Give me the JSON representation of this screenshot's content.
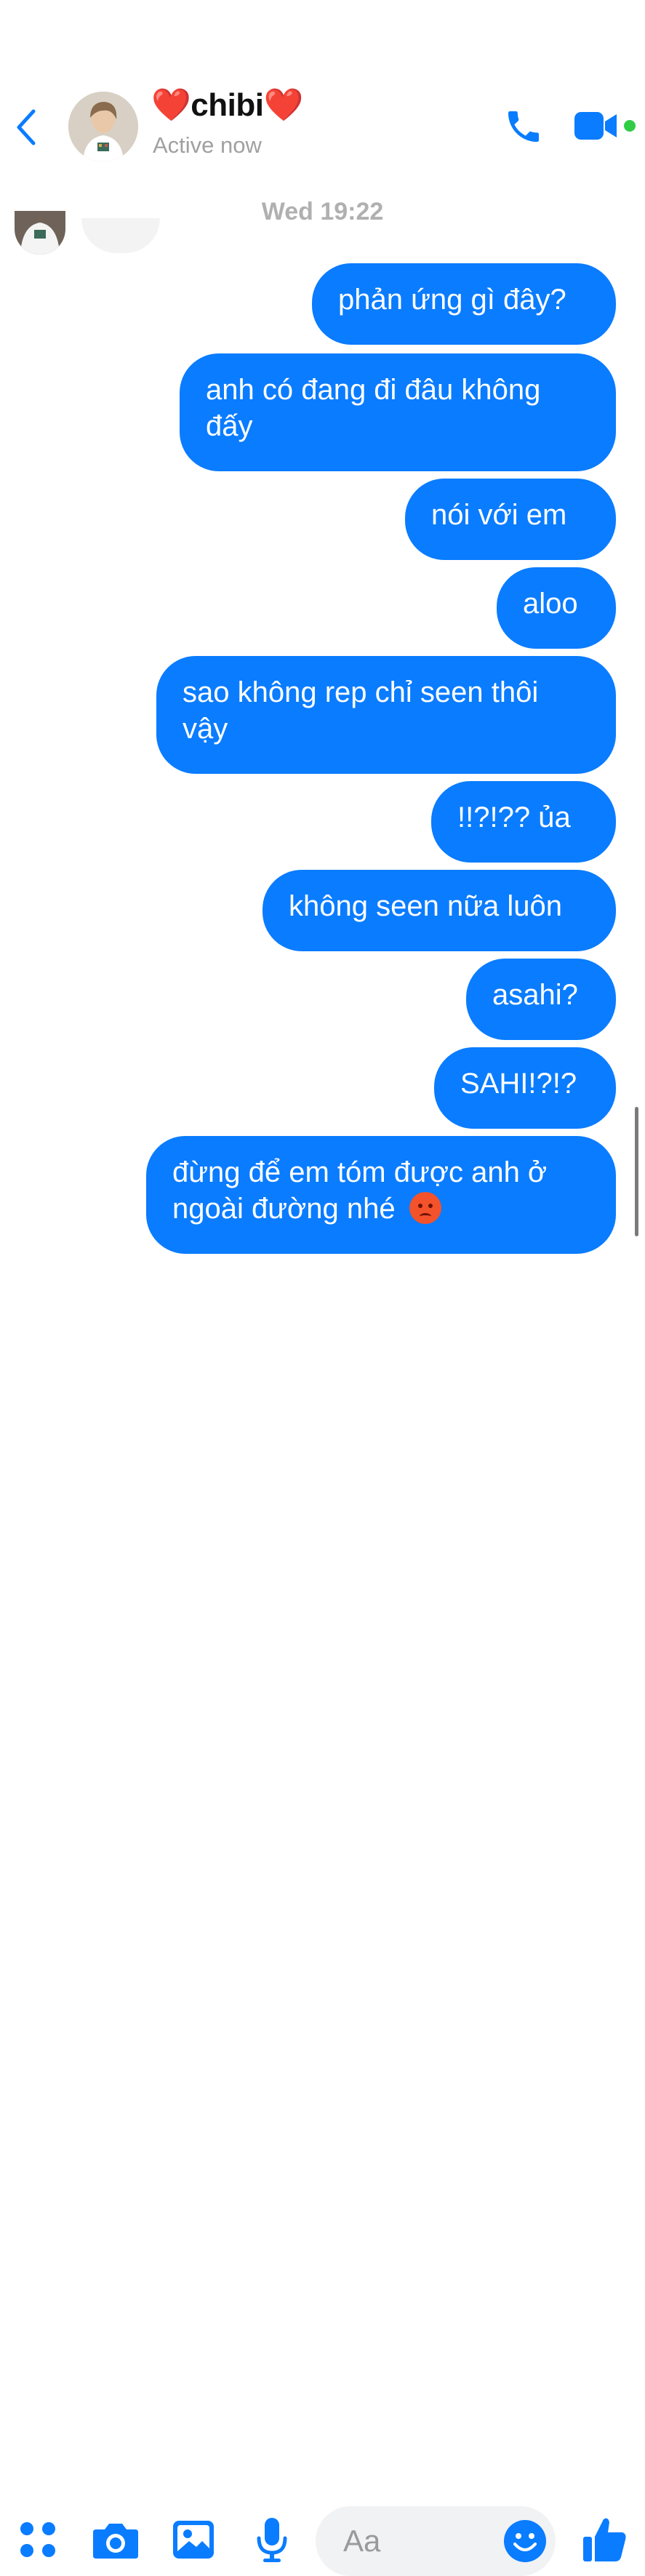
{
  "header": {
    "back_icon": "chevron-left-icon",
    "avatar_icon": "profile-photo",
    "contact_name": "❤️chibi❤️",
    "status": "Active now",
    "call_icon": "phone-icon",
    "video_icon": "video-camera-icon",
    "accent_color": "#0a7cff",
    "active_color": "#31cc46"
  },
  "thread": {
    "timestamp": "Wed 19:22",
    "messages": [
      "phản ứng gì đây?",
      "anh có đang đi đâu không đấy",
      "nói với em",
      "aloo",
      "sao không rep chỉ seen thôi vậy",
      "!!?!?? ủa",
      "không seen nữa luôn",
      "asahi?",
      "SAHI!?!?",
      "đừng để em tóm được anh ở ngoài đường nhé"
    ],
    "last_message_emoji": "angry-face-emoji"
  },
  "composer": {
    "apps_icon": "apps-grid-icon",
    "camera_icon": "camera-icon",
    "gallery_icon": "image-icon",
    "mic_icon": "microphone-icon",
    "placeholder": "Aa",
    "emoji_icon": "smiley-icon",
    "like_icon": "thumbs-up-icon"
  }
}
